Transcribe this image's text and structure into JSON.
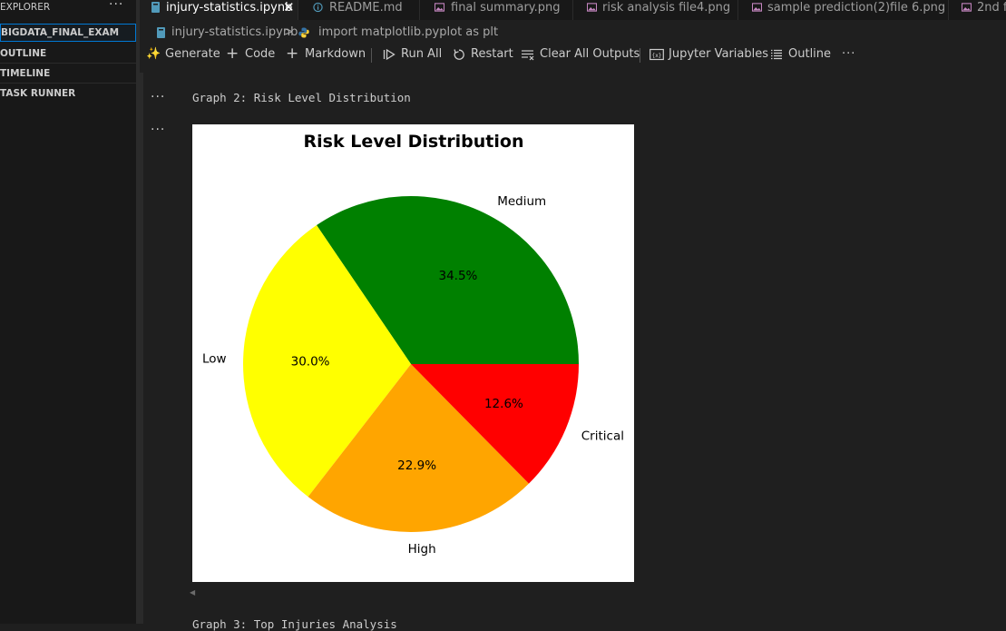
{
  "sidebar": {
    "explorer_label": "EXPLORER",
    "more_label": "···",
    "project_label": "BIGDATA_FINAL_EXAM",
    "outline_label": "OUTLINE",
    "timeline_label": "TIMELINE",
    "task_runner_label": "TASK RUNNER"
  },
  "tabs": [
    {
      "label": "injury-statistics.ipynb",
      "icon": "notebook-icon",
      "active": true
    },
    {
      "label": "README.md",
      "icon": "info-icon",
      "active": false
    },
    {
      "label": "final summary.png",
      "icon": "image-icon",
      "active": false
    },
    {
      "label": "risk analysis file4.png",
      "icon": "image-icon",
      "active": false
    },
    {
      "label": "sample prediction(2)file 6.png",
      "icon": "image-icon",
      "active": false
    },
    {
      "label": "2nd f",
      "icon": "image-icon",
      "active": false
    }
  ],
  "tab_close_glyph": "✕",
  "breadcrumb": {
    "file": "injury-statistics.ipynb",
    "separator": ">",
    "cell": "import matplotlib.pyplot as plt"
  },
  "toolbar": {
    "generate": "Generate",
    "code": "Code",
    "markdown": "Markdown",
    "run_all": "Run All",
    "restart": "Restart",
    "clear_outputs": "Clear All Outputs",
    "variables": "Jupyter Variables",
    "outline": "Outline",
    "more": "···"
  },
  "cells": {
    "more_glyph": "···",
    "text_output": "Graph 2: Risk Level Distribution",
    "next_text_output": "Graph 3: Top Injuries Analysis"
  },
  "colors": {
    "accent": "#0078d4",
    "editor_bg": "#1f1f1f",
    "sidebar_bg": "#181818",
    "image_icon": "#c586c0",
    "notebook_icon": "#519aba"
  },
  "chart_data": {
    "type": "pie",
    "title": "Risk Level Distribution",
    "slices": [
      {
        "label": "Medium",
        "value": 34.5,
        "pct_label": "34.5%",
        "color": "#008000"
      },
      {
        "label": "Low",
        "value": 30.0,
        "pct_label": "30.0%",
        "color": "#ffff00"
      },
      {
        "label": "High",
        "value": 22.9,
        "pct_label": "22.9%",
        "color": "#ffa500"
      },
      {
        "label": "Critical",
        "value": 12.6,
        "pct_label": "12.6%",
        "color": "#ff0000"
      }
    ],
    "start_angle_deg": 0,
    "direction": "counterclockwise",
    "legend": false
  }
}
